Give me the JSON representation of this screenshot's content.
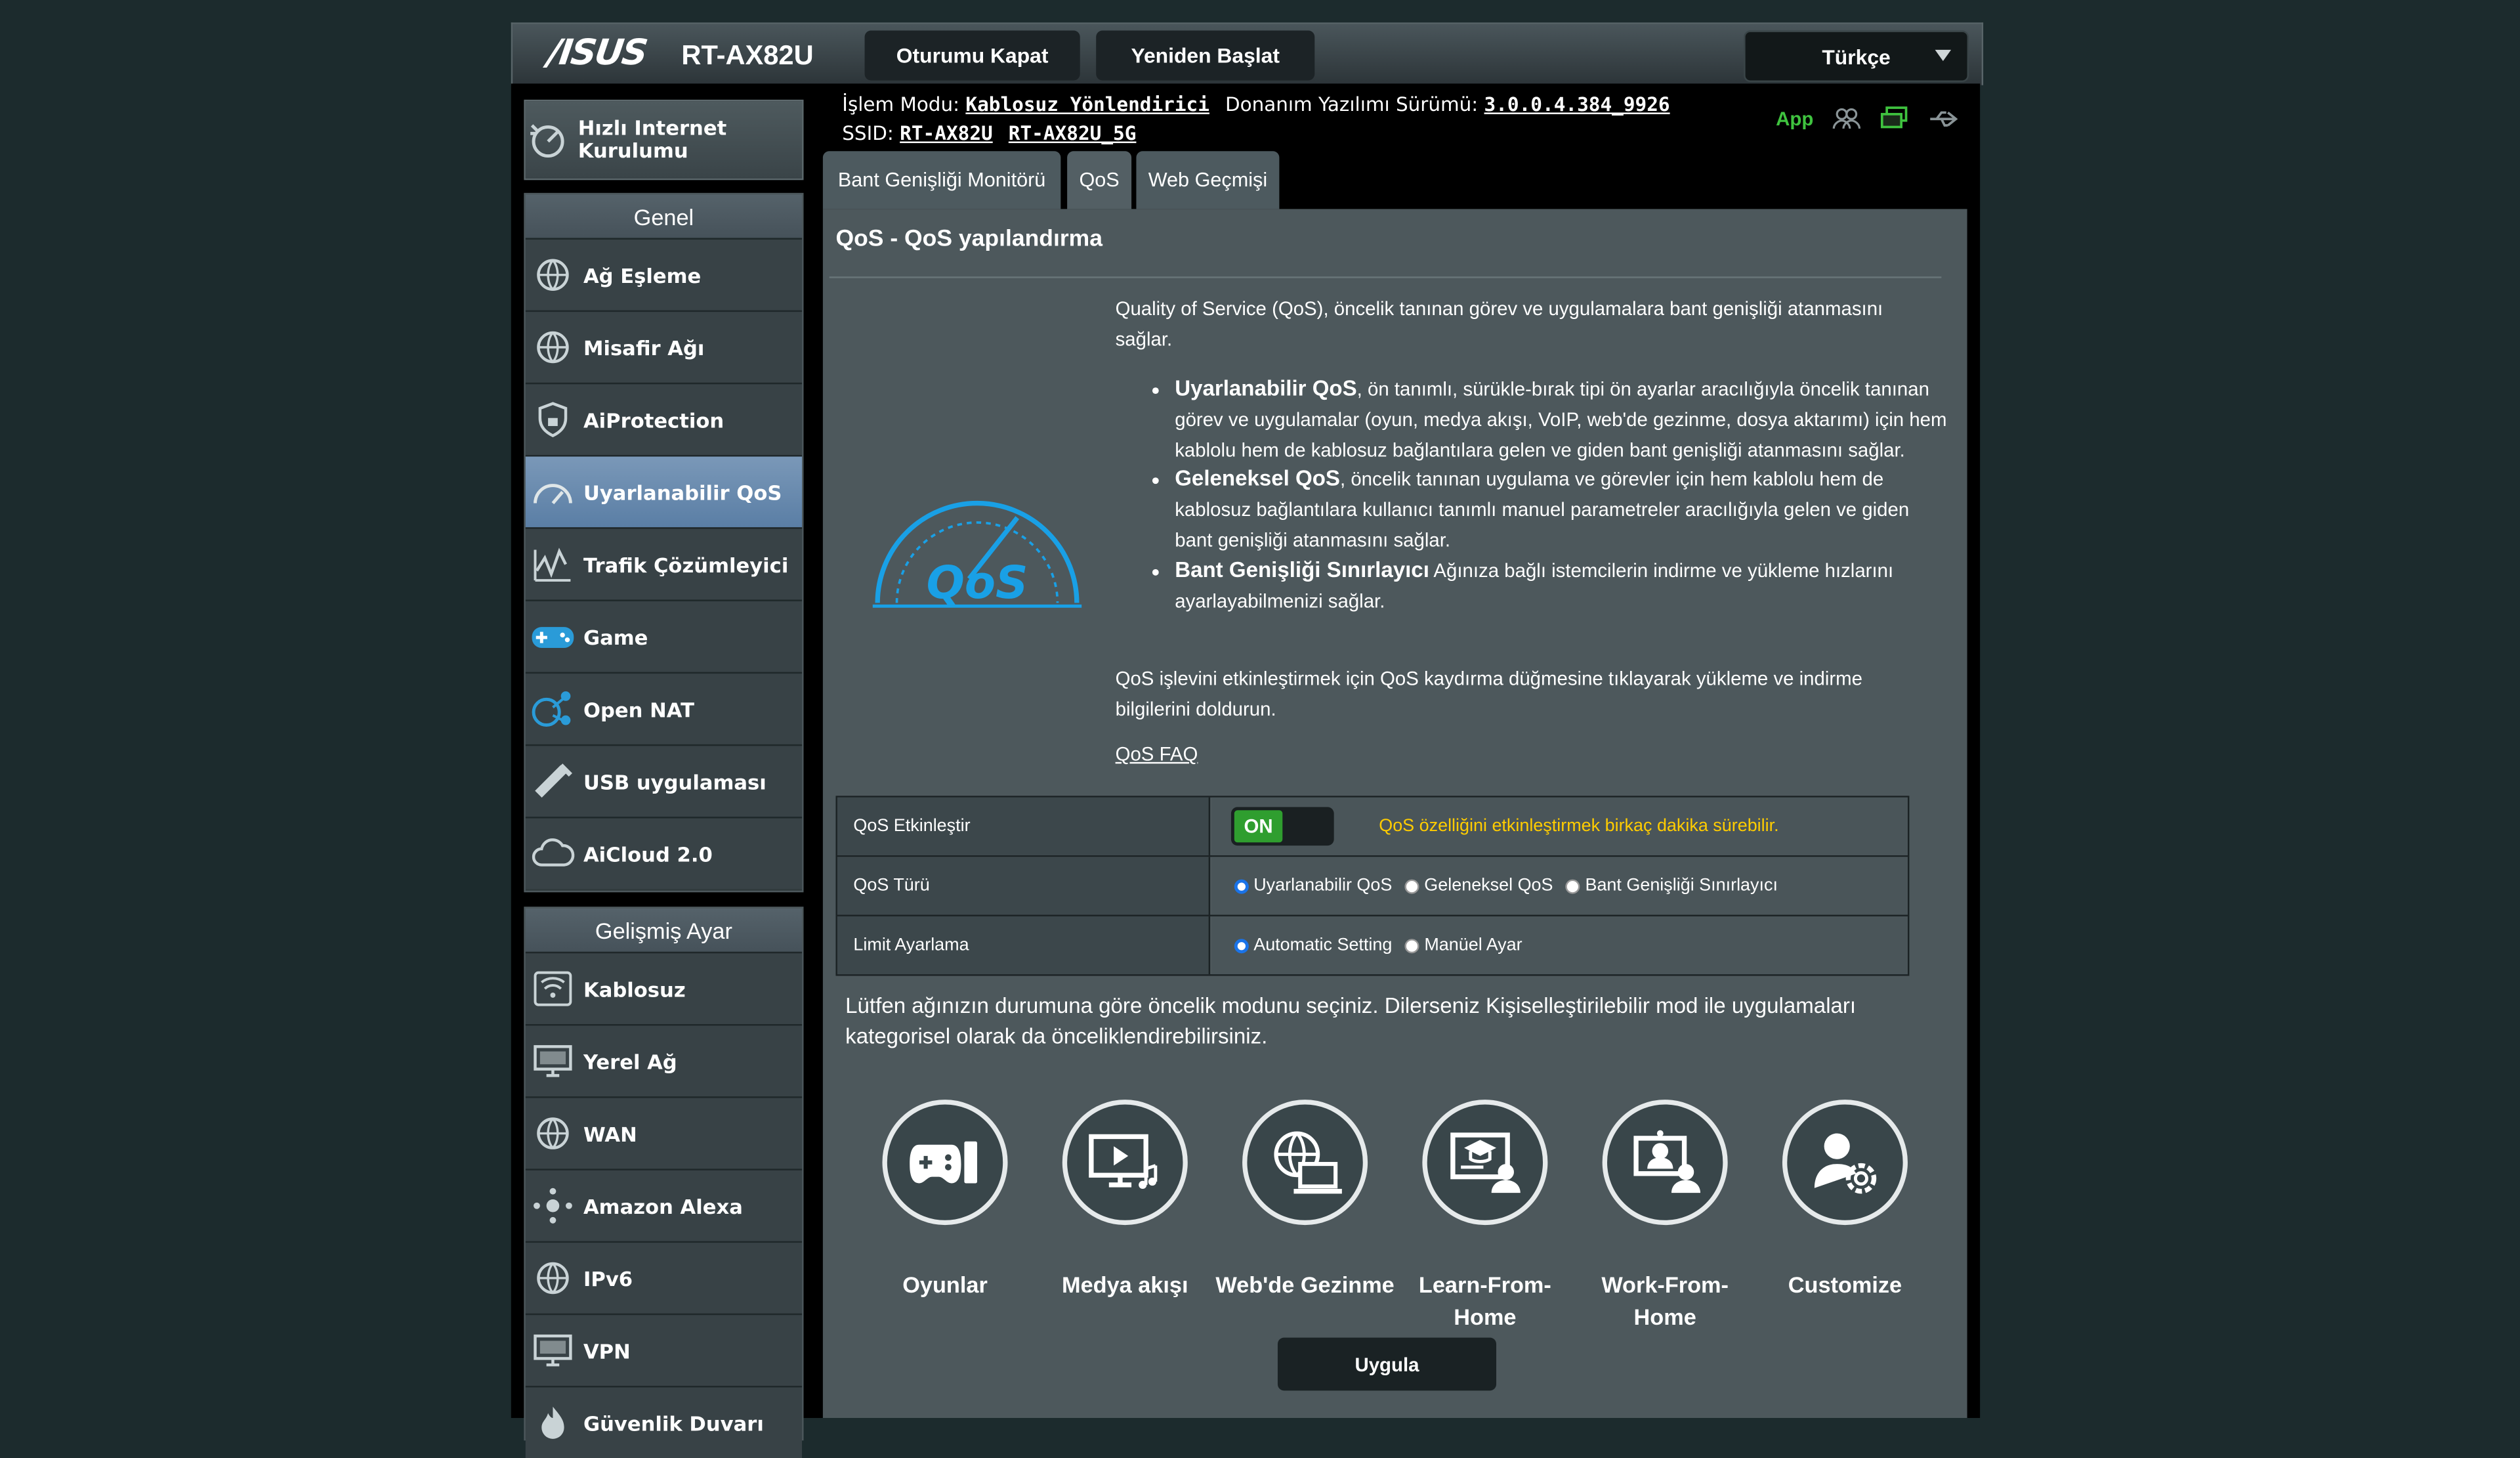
{
  "header": {
    "brand": "/ISUS",
    "model": "RT-AX82U",
    "logout": "Oturumu Kapat",
    "reboot": "Yeniden Başlat",
    "language": "Türkçe"
  },
  "info": {
    "mode_label": "İşlem Modu:",
    "mode_value": "Kablosuz Yönlendirici",
    "fw_label": "Donanım Yazılımı Sürümü:",
    "fw_value": "3.0.0.4.384_9926",
    "ssid_label": "SSID:",
    "ssid_1": "RT-AX82U",
    "ssid_2": "RT-AX82U_5G",
    "app_label": "App"
  },
  "sidebar": {
    "quick_setup": "Hızlı Internet Kurulumu",
    "general_header": "Genel",
    "general": [
      {
        "label": "Ağ Eşleme",
        "icon": "globe"
      },
      {
        "label": "Misafir Ağı",
        "icon": "globe"
      },
      {
        "label": "AiProtection",
        "icon": "lock"
      },
      {
        "label": "Uyarlanabilir QoS",
        "icon": "gauge"
      },
      {
        "label": "Trafik Çözümleyici",
        "icon": "chart"
      },
      {
        "label": "Game",
        "icon": "gamepad"
      },
      {
        "label": "Open NAT",
        "icon": "network"
      },
      {
        "label": "USB uygulaması",
        "icon": "usb"
      },
      {
        "label": "AiCloud 2.0",
        "icon": "cloud"
      }
    ],
    "advanced_header": "Gelişmiş Ayar",
    "advanced": [
      {
        "label": "Kablosuz",
        "icon": "wifi"
      },
      {
        "label": "Yerel Ağ",
        "icon": "monitor"
      },
      {
        "label": "WAN",
        "icon": "globe"
      },
      {
        "label": "Amazon Alexa",
        "icon": "alexa"
      },
      {
        "label": "IPv6",
        "icon": "globe"
      },
      {
        "label": "VPN",
        "icon": "monitor"
      },
      {
        "label": "Güvenlik Duvarı",
        "icon": "fire"
      }
    ]
  },
  "tabs": [
    "Bant Genişliği Monitörü",
    "QoS",
    "Web Geçmişi"
  ],
  "main": {
    "title": "QoS - QoS yapılandırma",
    "intro": "Quality of Service (QoS), öncelik tanınan görev ve uygulamalara bant genişliği atanmasını sağlar.",
    "bullets": [
      {
        "bold": "Uyarlanabilir QoS",
        "text": ", ön tanımlı, sürükle-bırak tipi ön ayarlar aracılığıyla öncelik tanınan görev ve uygulamalar (oyun, medya akışı, VoIP, web'de gezinme, dosya aktarımı) için hem kablolu hem de kablosuz bağlantılara gelen ve giden bant genişliği atanmasını sağlar."
      },
      {
        "bold": "Geleneksel QoS",
        "text": ", öncelik tanınan uygulama ve görevler için hem kablolu hem de kablosuz bağlantılara kullanıcı tanımlı manuel parametreler aracılığıyla gelen ve giden bant genişliği atanmasını sağlar."
      },
      {
        "bold": "Bant Genişliği Sınırlayıcı",
        "text": " Ağınıza bağlı istemcilerin indirme ve yükleme hızlarını ayarlayabilmenizi sağlar."
      }
    ],
    "enable_text": "QoS işlevini etkinleştirmek için QoS kaydırma düğmesine tıklayarak yükleme ve indirme bilgilerini doldurun.",
    "faq": "QoS FAQ",
    "logo_text": "QoS"
  },
  "settings": {
    "enable_label": "QoS Etkinleştir",
    "toggle_state": "ON",
    "enable_note": "QoS özelliğini etkinleştirmek birkaç dakika sürebilir.",
    "type_label": "QoS Türü",
    "type_options": [
      "Uyarlanabilir QoS",
      "Geleneksel QoS",
      "Bant Genişliği Sınırlayıcı"
    ],
    "limit_label": "Limit Ayarlama",
    "limit_options": [
      "Automatic Setting",
      "Manüel Ayar"
    ]
  },
  "prompt": "Lütfen ağınızın durumuna göre öncelik modunu seçiniz. Dilerseniz Kişiselleştirilebilir mod ile uygulamaları kategorisel olarak da önceliklendirebilirsiniz.",
  "modes": [
    {
      "label": "Oyunlar",
      "icon": "gamepad"
    },
    {
      "label": "Medya akışı",
      "icon": "media"
    },
    {
      "label": "Web'de Gezinme",
      "icon": "web"
    },
    {
      "label": "Learn-From-Home",
      "icon": "learn"
    },
    {
      "label": "Work-From-Home",
      "icon": "work"
    },
    {
      "label": "Customize",
      "icon": "customize"
    }
  ],
  "apply": "Uygula"
}
